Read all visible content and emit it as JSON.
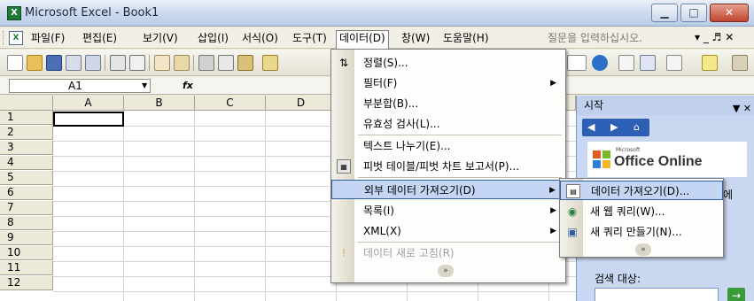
{
  "window": {
    "title": "Microsoft Excel - Book1",
    "minimize": "▁",
    "maximize": "□",
    "close": "✕"
  },
  "menubar": {
    "items": [
      "파일(F)",
      "편집(E)",
      "보기(V)",
      "삽입(I)",
      "서식(O)",
      "도구(T)",
      "데이터(D)",
      "창(W)",
      "도움말(H)"
    ],
    "active": "데이터(D)",
    "ask_placeholder": "질문을 입력하십시오.",
    "doc_controls": "▾ _ ♬ ✕"
  },
  "formulabar": {
    "name_box": "A1",
    "fx": "fx"
  },
  "grid": {
    "columns": [
      "A",
      "B",
      "C",
      "D"
    ],
    "rows": [
      "1",
      "2",
      "3",
      "4",
      "5",
      "6",
      "7",
      "8",
      "9",
      "10",
      "11",
      "12"
    ],
    "selected_cell": "A1"
  },
  "data_menu": {
    "items": [
      {
        "label": "정렬(S)...",
        "icon": "sort-icon",
        "submenu": false,
        "disabled": false
      },
      {
        "label": "필터(F)",
        "icon": "",
        "submenu": true,
        "disabled": false
      },
      {
        "label": "부분합(B)...",
        "icon": "",
        "submenu": false,
        "disabled": false
      },
      {
        "label": "유효성 검사(L)...",
        "icon": "",
        "submenu": false,
        "disabled": false
      },
      {
        "label": "텍스트 나누기(E)...",
        "icon": "",
        "submenu": false,
        "disabled": false
      },
      {
        "label": "피벗 테이블/피벗 차트 보고서(P)...",
        "icon": "pivot-table-icon",
        "submenu": false,
        "disabled": false
      },
      {
        "label": "외부 데이터 가져오기(D)",
        "icon": "",
        "submenu": true,
        "disabled": false,
        "highlighted": true
      },
      {
        "label": "목록(I)",
        "icon": "",
        "submenu": true,
        "disabled": false
      },
      {
        "label": "XML(X)",
        "icon": "",
        "submenu": true,
        "disabled": false
      },
      {
        "label": "데이터 새로 고침(R)",
        "icon": "refresh-icon",
        "submenu": false,
        "disabled": true
      }
    ],
    "more": "»"
  },
  "external_data_submenu": {
    "items": [
      {
        "label": "데이터 가져오기(D)...",
        "icon": "import-data-icon",
        "highlighted": true
      },
      {
        "label": "새 웹 쿼리(W)...",
        "icon": "web-query-icon"
      },
      {
        "label": "새 쿼리 만들기(N)...",
        "icon": "new-query-icon"
      }
    ],
    "more": "»"
  },
  "task_pane": {
    "title": "시작",
    "logo_small": "Microsoft",
    "logo_main": "Office Online",
    "partial_text": "에",
    "search_label": "검색 대상:",
    "go": "→"
  }
}
